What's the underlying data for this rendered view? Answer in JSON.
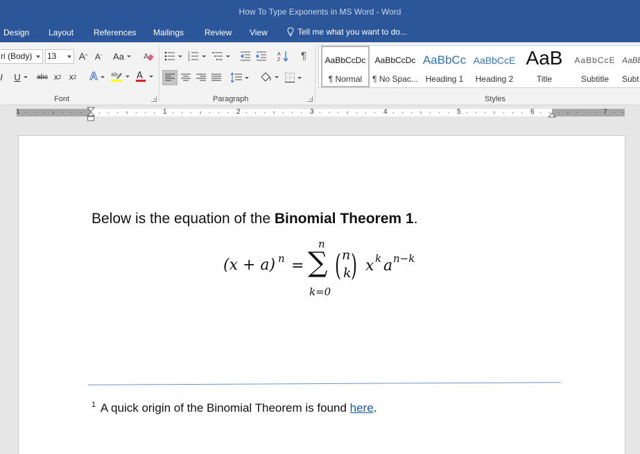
{
  "window": {
    "title": "How To Type Exponents in MS Word - Word"
  },
  "tabs": [
    "Design",
    "Layout",
    "References",
    "Mailings",
    "Review",
    "View"
  ],
  "tell_me": {
    "placeholder": "Tell me what you want to do...",
    "icon": "lightbulb-icon"
  },
  "font_group": {
    "label": "Font",
    "font_name": "ri (Body)",
    "font_size": "13",
    "grow_label": "A",
    "shrink_label": "A",
    "change_case_label": "Aa",
    "bold_label": "I",
    "underline_label": "U",
    "strike_label": "abc",
    "subscript_label": "x",
    "subscript_mark": "2",
    "superscript_label": "x",
    "superscript_mark": "2",
    "text_effects_label": "A",
    "font_color_label": "A",
    "highlight_color": "#ffff00",
    "font_color": "#e02020"
  },
  "paragraph_group": {
    "label": "Paragraph",
    "pilcrow": "¶"
  },
  "styles_group": {
    "label": "Styles",
    "items": [
      {
        "sample": "AaBbCcDc",
        "name": "¶ Normal",
        "selected": true
      },
      {
        "sample": "AaBbCcDc",
        "name": "¶ No Spac..."
      },
      {
        "sample": "AaBbCc",
        "name": "Heading 1"
      },
      {
        "sample": "AaBbCcE",
        "name": "Heading 2"
      },
      {
        "sample": "AaB",
        "name": "Title"
      },
      {
        "sample": "AaBbCcE",
        "name": "Subtitle"
      },
      {
        "sample": "AaBb",
        "name": "Subt"
      }
    ]
  },
  "ruler": {
    "numbers": [
      "1",
      "1",
      "2",
      "3",
      "4",
      "5",
      "6",
      "7"
    ]
  },
  "document": {
    "sentence_start": "Below is the equation of the ",
    "sentence_bold": "Binomial Theorem 1",
    "sentence_end": ".",
    "equation": {
      "lhs_base": "(x + a)",
      "lhs_exp": "n",
      "equals": "=",
      "sum_symbol": "∑",
      "sum_upper": "n",
      "sum_lower": "k=0",
      "binom_top": "n",
      "binom_bottom": "k",
      "x_base": "x",
      "x_exp": "k",
      "a_base": "a",
      "a_exp": "n−k"
    },
    "footnote": {
      "number": "1",
      "text": " A quick origin of the Binomial Theorem is found ",
      "link": "here",
      "end": "."
    }
  }
}
